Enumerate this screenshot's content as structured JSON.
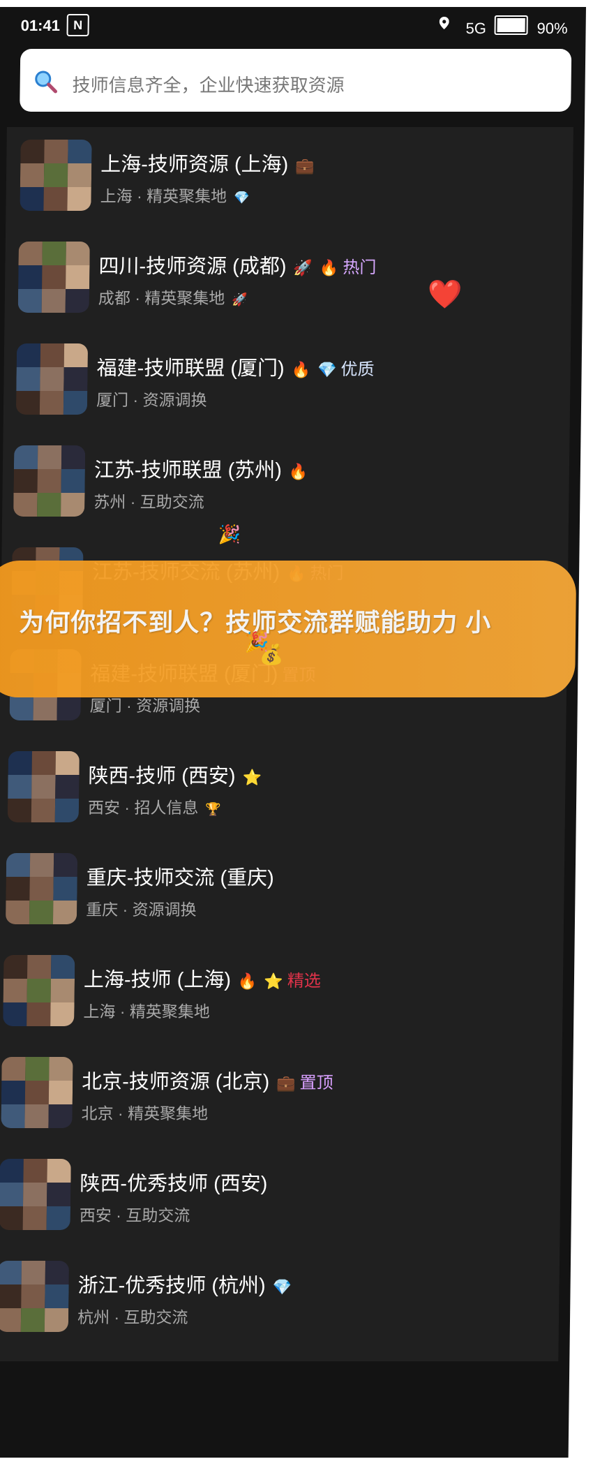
{
  "status_bar": {
    "time": "01:41",
    "notification_badge": "N",
    "network": "5G",
    "battery": "90%",
    "location_icon": "location-pin-icon"
  },
  "search": {
    "placeholder": "技师信息齐全，企业快速获取资源",
    "icon": "search-icon"
  },
  "list": {
    "items": [
      {
        "title": "上海-技师资源 (上海)",
        "title_emoji": "💼",
        "subtitle": "上海 · 精英聚集地",
        "sub_emoji": "💎",
        "tag_emoji": "",
        "tag": ""
      },
      {
        "title": "四川-技师资源 (成都)",
        "title_emoji": "🚀",
        "subtitle": "成都 · 精英聚集地",
        "sub_emoji": "🚀",
        "tag_emoji": "🔥",
        "tag": "热门"
      },
      {
        "title": "福建-技师联盟 (厦门)",
        "title_emoji": "🔥",
        "subtitle": "厦门 · 资源调换",
        "sub_emoji": "",
        "tag_emoji": "💎",
        "tag": "优质"
      },
      {
        "title": "江苏-技师联盟 (苏州)",
        "title_emoji": "🔥",
        "subtitle": "苏州 · 互助交流",
        "sub_emoji": "",
        "tag_emoji": "",
        "tag": ""
      },
      {
        "title": "江苏-技师交流 (苏州)",
        "title_emoji": "🔥",
        "subtitle": "",
        "sub_emoji": "",
        "tag_emoji": "",
        "tag": "热门"
      },
      {
        "title": "福建-技师联盟 (厦门)",
        "title_emoji": "",
        "subtitle": "厦门 · 资源调换",
        "sub_emoji": "",
        "tag_emoji": "",
        "tag": "置顶"
      },
      {
        "title": "陕西-技师 (西安)",
        "title_emoji": "⭐",
        "subtitle": "西安 · 招人信息",
        "sub_emoji": "🏆",
        "tag_emoji": "",
        "tag": ""
      },
      {
        "title": "重庆-技师交流 (重庆)",
        "title_emoji": "",
        "subtitle": "重庆 · 资源调换",
        "sub_emoji": "",
        "tag_emoji": "",
        "tag": ""
      },
      {
        "title": "上海-技师 (上海)",
        "title_emoji": "🔥",
        "subtitle": "上海 · 精英聚集地",
        "sub_emoji": "",
        "tag_emoji": "⭐",
        "tag": "精选"
      },
      {
        "title": "北京-技师资源 (北京)",
        "title_emoji": "💼",
        "subtitle": "北京 · 精英聚集地",
        "sub_emoji": "",
        "tag_emoji": "",
        "tag": "置顶"
      },
      {
        "title": "陕西-优秀技师 (西安)",
        "title_emoji": "",
        "subtitle": "西安 · 互助交流",
        "sub_emoji": "",
        "tag_emoji": "",
        "tag": ""
      },
      {
        "title": "浙江-优秀技师 (杭州)",
        "title_emoji": "💎",
        "subtitle": "杭州 · 互助交流",
        "sub_emoji": "",
        "tag_emoji": "",
        "tag": ""
      }
    ]
  },
  "banner": {
    "text": "为何你招不到人？技师交流群赋能助力 小",
    "emojis": [
      "🎉",
      "💰"
    ]
  },
  "decorations": [
    "❤️",
    "🎉"
  ],
  "colors": {
    "background": "#131313",
    "list_bg": "#202020",
    "banner_orange": "#f39a1e",
    "tag_pink": "#d7a8ff",
    "tag_red": "#e0334a"
  }
}
